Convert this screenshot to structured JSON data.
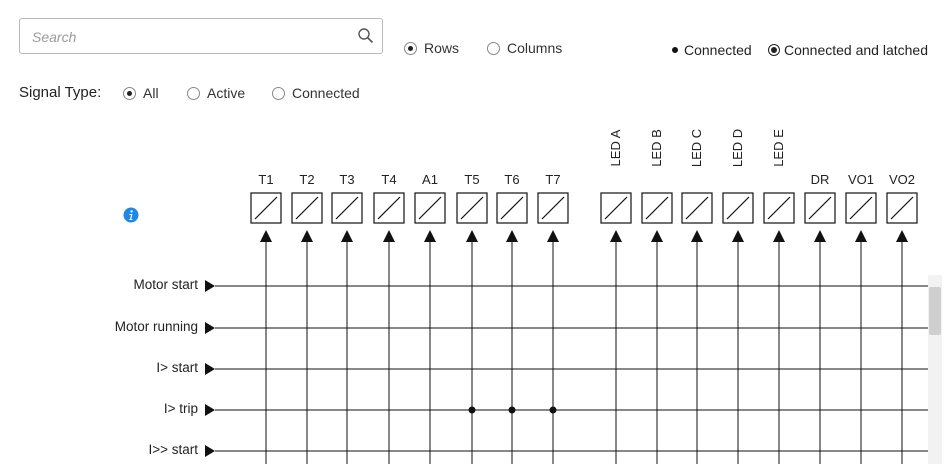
{
  "search": {
    "placeholder": "Search",
    "value": ""
  },
  "orientation": {
    "options": [
      {
        "label": "Rows",
        "selected": true
      },
      {
        "label": "Columns",
        "selected": false
      }
    ]
  },
  "legend": {
    "connected": "Connected",
    "latched": "Connected and latched"
  },
  "signal_type": {
    "label": "Signal Type:",
    "options": [
      {
        "label": "All",
        "selected": true
      },
      {
        "label": "Active",
        "selected": false
      },
      {
        "label": "Connected",
        "selected": false
      }
    ]
  },
  "columns": [
    "T1",
    "T2",
    "T3",
    "T4",
    "A1",
    "T5",
    "T6",
    "T7",
    "LED A",
    "LED B",
    "LED C",
    "LED D",
    "LED E",
    "DR",
    "VO1",
    "VO2"
  ],
  "rows": [
    "Motor start",
    "Motor running",
    "I> start",
    "I> trip",
    "I>> start"
  ],
  "connections": [
    {
      "row": "I> trip",
      "column": "T5",
      "type": "connected"
    },
    {
      "row": "I> trip",
      "column": "T6",
      "type": "connected"
    },
    {
      "row": "I> trip",
      "column": "T7",
      "type": "connected"
    }
  ],
  "colors": {
    "info_icon": "#1e88e5",
    "line": "#111111",
    "scrollbar_thumb": "#cfcfcf"
  },
  "icons": {
    "search": "search-icon",
    "info": "info-icon"
  }
}
